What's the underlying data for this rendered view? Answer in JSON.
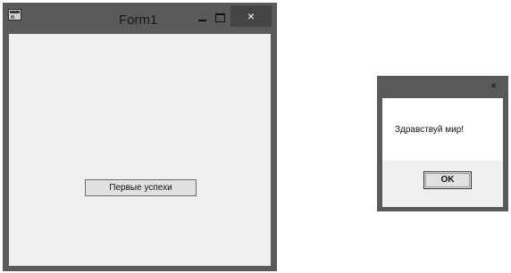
{
  "form": {
    "title": "Form1",
    "icons": {
      "app": "app-icon",
      "minimize": "minimize-icon",
      "maximize": "maximize-icon",
      "close": "close-icon"
    },
    "close_glyph": "×",
    "button_label": "Первые успехи"
  },
  "messagebox": {
    "close_glyph": "×",
    "message": "Здравствуй мир!",
    "ok_label": "OK"
  },
  "colors": {
    "window_frame": "#5a5a5a",
    "close_button": "#444444",
    "client_area": "#f0f0f0",
    "button_face": "#e1e1e1"
  }
}
